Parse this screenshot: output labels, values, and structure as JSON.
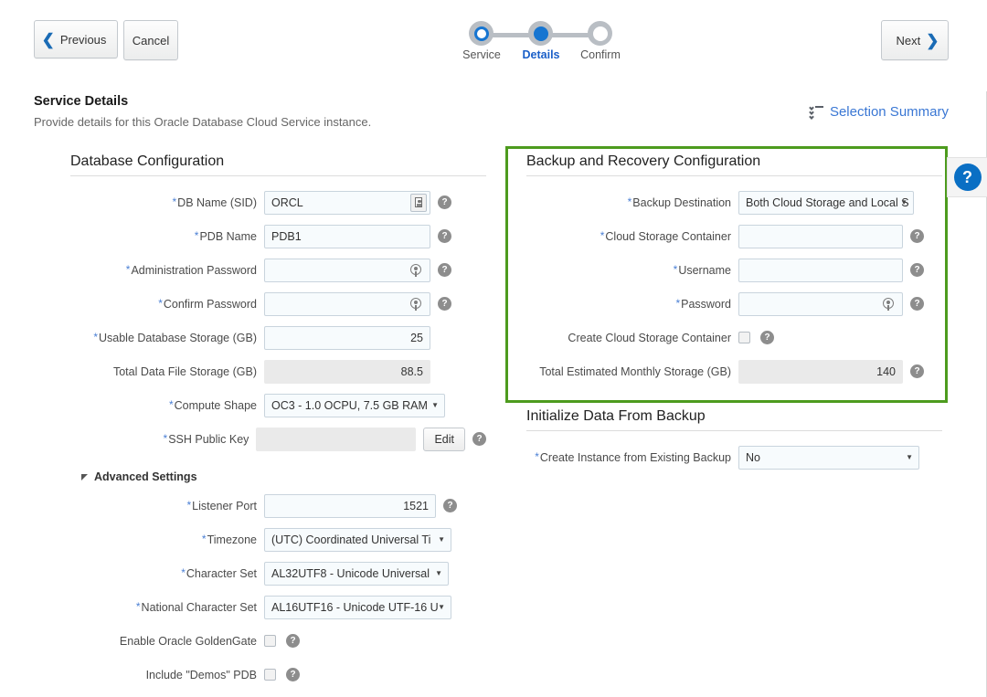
{
  "toolbar": {
    "previous_label": "Previous",
    "cancel_label": "Cancel",
    "next_label": "Next",
    "prev_icon": "chevron-left-icon",
    "next_icon": "chevron-right-icon"
  },
  "stepper": {
    "steps": [
      {
        "label": "Service",
        "state": "visited"
      },
      {
        "label": "Details",
        "state": "current"
      },
      {
        "label": "Confirm",
        "state": "upcoming"
      }
    ]
  },
  "header": {
    "title": "Service Details",
    "subtitle": "Provide details for this Oracle Database Cloud Service instance.",
    "selection_summary_label": "Selection Summary",
    "selection_summary_icon": "list-checklist-icon",
    "link_color": "#3a77d4"
  },
  "side_help": {
    "icon": "question-mark-icon",
    "label": "?",
    "color": "#0a6fc4"
  },
  "highlight": {
    "color": "#4d9b1e",
    "target": "backup-and-recovery-configuration"
  },
  "database_configuration": {
    "title": "Database Configuration",
    "fields": [
      {
        "label": "DB Name (SID)",
        "required": true,
        "type": "text",
        "value": "ORCL",
        "trailing_icon": "card-icon",
        "help": true
      },
      {
        "label": "PDB Name",
        "required": true,
        "type": "text",
        "value": "PDB1",
        "help": true
      },
      {
        "label": "Administration Password",
        "required": true,
        "type": "password",
        "value": "",
        "trailing_icon": "password-key-icon",
        "help": true
      },
      {
        "label": "Confirm Password",
        "required": true,
        "type": "password",
        "value": "",
        "trailing_icon": "password-key-icon",
        "help": true
      },
      {
        "label": "Usable Database Storage (GB)",
        "required": true,
        "type": "number",
        "value": "25",
        "help": false
      },
      {
        "label": "Total Data File Storage (GB)",
        "required": false,
        "type": "number",
        "readonly": true,
        "value": "88.5",
        "help": false
      },
      {
        "label": "Compute Shape",
        "required": true,
        "type": "select",
        "value": "OC3 - 1.0 OCPU, 7.5 GB RAM",
        "help": false
      },
      {
        "label": "SSH Public Key",
        "required": true,
        "type": "text",
        "readonly": true,
        "value": "",
        "button_label": "Edit",
        "help": true
      }
    ]
  },
  "advanced_settings": {
    "title": "Advanced Settings",
    "expanded": true,
    "fields": [
      {
        "label": "Listener Port",
        "required": true,
        "type": "number",
        "value": "1521",
        "help": true
      },
      {
        "label": "Timezone",
        "required": true,
        "type": "select",
        "value": "(UTC) Coordinated Universal Ti",
        "help": false
      },
      {
        "label": "Character Set",
        "required": true,
        "type": "select",
        "value": "AL32UTF8 - Unicode Universal",
        "help": false
      },
      {
        "label": "National Character Set",
        "required": true,
        "type": "select",
        "value": "AL16UTF16 - Unicode UTF-16 U",
        "help": false
      },
      {
        "label": "Enable Oracle GoldenGate",
        "required": false,
        "type": "checkbox",
        "checked": false,
        "help": true
      },
      {
        "label": "Include \"Demos\" PDB",
        "required": false,
        "type": "checkbox",
        "checked": false,
        "help": true
      }
    ]
  },
  "backup_configuration": {
    "title": "Backup and Recovery Configuration",
    "fields": [
      {
        "label": "Backup Destination",
        "required": true,
        "type": "select",
        "value": "Both Cloud Storage and Local S",
        "help": false
      },
      {
        "label": "Cloud Storage Container",
        "required": true,
        "type": "text",
        "value": "",
        "help": true
      },
      {
        "label": "Username",
        "required": true,
        "type": "text",
        "value": "",
        "help": true
      },
      {
        "label": "Password",
        "required": true,
        "type": "password",
        "value": "",
        "trailing_icon": "password-key-icon",
        "help": true
      },
      {
        "label": "Create Cloud Storage Container",
        "required": false,
        "type": "checkbox",
        "checked": false,
        "help": true
      },
      {
        "label": "Total Estimated Monthly Storage (GB)",
        "required": false,
        "type": "number",
        "readonly": true,
        "value": "140",
        "help": true
      }
    ]
  },
  "initialize_backup": {
    "title": "Initialize Data From Backup",
    "fields": [
      {
        "label": "Create Instance from Existing Backup",
        "required": true,
        "type": "select",
        "value": "No",
        "help": false
      }
    ]
  }
}
